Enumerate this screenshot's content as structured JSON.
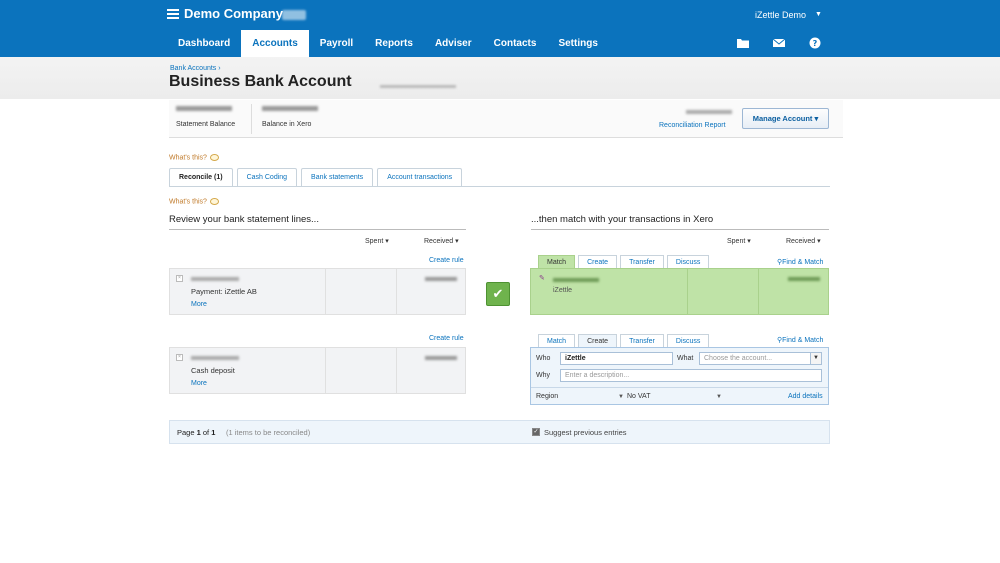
{
  "header": {
    "company": "Demo Company",
    "user": "iZettle Demo",
    "nav": [
      {
        "label": "Dashboard",
        "active": false
      },
      {
        "label": "Accounts",
        "active": true
      },
      {
        "label": "Payroll",
        "active": false
      },
      {
        "label": "Reports",
        "active": false
      },
      {
        "label": "Adviser",
        "active": false
      },
      {
        "label": "Contacts",
        "active": false
      },
      {
        "label": "Settings",
        "active": false
      }
    ],
    "icons": [
      "folder-icon",
      "mail-icon",
      "help-icon"
    ]
  },
  "page": {
    "breadcrumb": "Bank Accounts ›",
    "title": "Business Bank Account"
  },
  "balances": {
    "statement_label": "Statement Balance",
    "xero_label": "Balance in Xero",
    "reconciliation_link": "Reconciliation Report",
    "manage_button": "Manage Account ▾"
  },
  "help_text": "What's this?",
  "tabs": [
    "Reconcile (1)",
    "Cash Coding",
    "Bank statements",
    "Account transactions"
  ],
  "left": {
    "heading": "Review your bank statement lines...",
    "spent": "Spent ▾",
    "received": "Received ▾",
    "create_rule": "Create rule",
    "lines": [
      {
        "description": "Payment: iZettle AB",
        "more": "More"
      },
      {
        "description": "Cash deposit",
        "more": "More"
      }
    ]
  },
  "right": {
    "heading": "...then match with your transactions in Xero",
    "spent": "Spent ▾",
    "received": "Received ▾",
    "tabs": [
      "Match",
      "Create",
      "Transfer",
      "Discuss"
    ],
    "find_match": "Find & Match",
    "match_name": "iZettle",
    "create": {
      "who_label": "Who",
      "who_value": "iZettle",
      "what_label": "What",
      "what_placeholder": "Choose the account...",
      "why_label": "Why",
      "why_placeholder": "Enter a description...",
      "region_label": "Region",
      "tax_value": "No VAT",
      "add_details": "Add details"
    }
  },
  "footer": {
    "page_prefix": "Page",
    "page_current": "1",
    "page_of": "of",
    "page_total": "1",
    "note": "(1 items to be reconciled)",
    "suggest": "Suggest previous entries"
  },
  "colors": {
    "brand": "#0b73bd",
    "match_green": "#bfe3a7",
    "ok_green": "#6fb34d"
  }
}
